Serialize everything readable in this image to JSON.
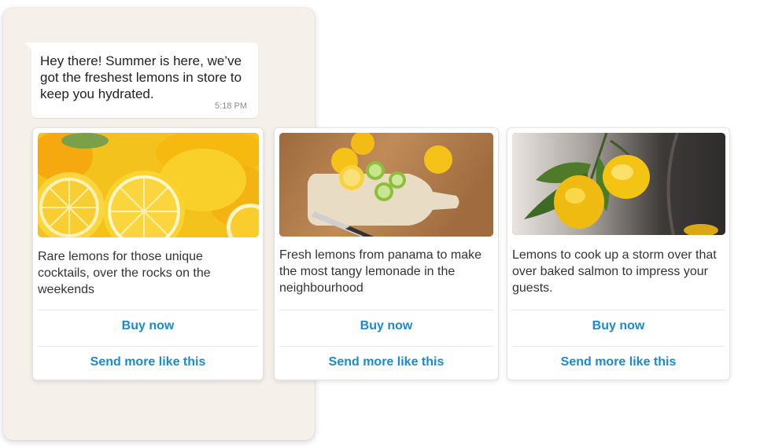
{
  "message": {
    "text": "Hey there! Summer is here, we’ve got the freshest lemons in store to keep you hydrated.",
    "time": "5:18 PM"
  },
  "cards": [
    {
      "image_icon": "lemon-slices-image",
      "description": "Rare lemons for those unique cocktails, over the rocks on the weekends",
      "actions": [
        "Buy now",
        "Send more like this"
      ]
    },
    {
      "image_icon": "cutting-board-lemons-image",
      "description": "Fresh lemons from panama to make the most tangy lemonade in the neighbourhood",
      "actions": [
        "Buy now",
        "Send more like this"
      ]
    },
    {
      "image_icon": "lemon-tree-branch-image",
      "description": "Lemons to cook up a storm over that over baked salmon to impress your guests.",
      "actions": [
        "Buy now",
        "Send more like this"
      ]
    }
  ],
  "colors": {
    "chat_background": "#f5f0ea",
    "action_text": "#1a8ad0",
    "lemon": "#f7c518"
  }
}
